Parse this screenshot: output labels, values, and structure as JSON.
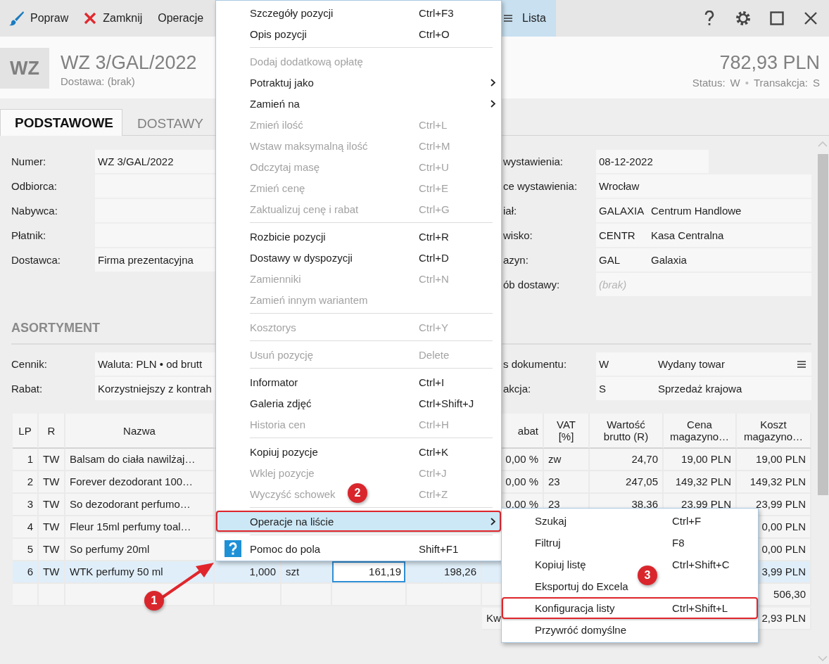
{
  "toolbar": {
    "buttons": [
      {
        "kind": "edit",
        "label": "Popraw"
      },
      {
        "kind": "close",
        "label": "Zamknij"
      },
      {
        "kind": "plain",
        "label": "Operacje"
      }
    ],
    "view_tab": {
      "label": "Lista",
      "selected": true
    }
  },
  "header": {
    "badge": "WZ",
    "title": "WZ 3/GAL/2022",
    "subtitle": "Dostawa: (brak)",
    "amount": "782,93 PLN",
    "status_separator": "•",
    "status": [
      {
        "label": "Status:",
        "value": "W"
      },
      {
        "label": "Transakcja:",
        "value": "S"
      }
    ]
  },
  "tabs": [
    {
      "label": "PODSTAWOWE",
      "selected": true
    },
    {
      "label": "DOSTAWY",
      "selected": false
    }
  ],
  "form_left": [
    {
      "label": "Numer:",
      "value": "WZ 3/GAL/2022"
    },
    {
      "label": "Odbiorca:"
    },
    {
      "label": "Nabywca:"
    },
    {
      "label": "Płatnik:"
    },
    {
      "label": "Dostawca:",
      "value": "Firma prezentacyjna"
    }
  ],
  "form_right": [
    {
      "kind": "date",
      "label": "wystawienia:",
      "value": "08-12-2022"
    },
    {
      "kind": "text",
      "label": "ce wystawienia:",
      "value": "Wrocław"
    },
    {
      "kind": "coded",
      "label": "iał:",
      "code": "GALAXIA",
      "value": "Centrum Handlowe"
    },
    {
      "kind": "coded",
      "label": "wisko:",
      "code": "CENTR",
      "value": "Kasa Centralna"
    },
    {
      "kind": "coded",
      "label": "azyn:",
      "code": "GAL",
      "value": "Galaxia"
    },
    {
      "kind": "text",
      "label": "ób dostawy:",
      "placeholder": "(brak)"
    }
  ],
  "section_title": "ASORTYMENT",
  "assortment_left": [
    {
      "label": "Cennik:",
      "value": "Waluta: PLN • od brutt"
    },
    {
      "label": "Rabat:",
      "value": "Korzystniejszy z kontrah"
    }
  ],
  "assortment_right": [
    {
      "label": "s dokumentu:",
      "code": "W",
      "value": "Wydany towar",
      "menu": true
    },
    {
      "label": "akcja:",
      "code": "S",
      "value": "Sprzedaż krajowa",
      "menu": false
    }
  ],
  "table": {
    "header": {
      "lp": "LP",
      "r": "R",
      "name": "Nazwa",
      "discount": "abat",
      "vat": "VAT [%]",
      "gross": "Wartość brutto (R)",
      "cost_price": "Cena magazyno…",
      "cost": "Koszt magazyno…"
    },
    "rows": [
      {
        "lp": "1",
        "r": "TW",
        "name": "Balsam do ciała nawilżaj…",
        "discount": "0,00 %",
        "vat": "zw",
        "gross": "24,70",
        "cost_price": "19,00 PLN",
        "cost": "19,00 PLN",
        "selected": false
      },
      {
        "lp": "2",
        "r": "TW",
        "name": "Forever dezodorant 100…",
        "discount": "0,00 %",
        "vat": "23",
        "gross": "247,05",
        "cost_price": "149,32 PLN",
        "cost": "149,32 PLN",
        "selected": false
      },
      {
        "lp": "3",
        "r": "TW",
        "name": "So dezodorant perfumo…",
        "discount": "0,00 %",
        "vat": "23",
        "gross": "38,36",
        "cost_price": "23,99 PLN",
        "cost": "23,99 PLN",
        "selected": false
      },
      {
        "lp": "4",
        "r": "TW",
        "name": "Fleur 15ml perfumy toal…",
        "cost": "0,00 PLN",
        "selected": false
      },
      {
        "lp": "5",
        "r": "TW",
        "name": "So perfumy 20ml",
        "cost": "0,00 PLN",
        "selected": false
      },
      {
        "lp": "6",
        "r": "TW",
        "name": "WTK perfumy 50 ml",
        "quantity": "1,000",
        "unit": "szt",
        "price": "161,19",
        "value": "198,26",
        "cost": "3,99 PLN",
        "selected": true,
        "editing": true
      }
    ],
    "footer": {
      "cost": "506,30"
    },
    "summary": {
      "label": "Kw",
      "value": "2,93 PLN"
    }
  },
  "context_menu": {
    "items": [
      {
        "kind": "command",
        "label": "Szczegóły pozycji",
        "shortcut": "Ctrl+F3",
        "disabled": false,
        "selected": false,
        "submenu": false,
        "outlined": false
      },
      {
        "kind": "command",
        "label": "Opis pozycji",
        "shortcut": "Ctrl+O",
        "disabled": false,
        "selected": false,
        "submenu": false,
        "outlined": false
      },
      {
        "kind": "separator"
      },
      {
        "kind": "command",
        "label": "Dodaj dodatkową opłatę",
        "disabled": true,
        "selected": false,
        "submenu": false,
        "outlined": false
      },
      {
        "kind": "command",
        "label": "Potraktuj jako",
        "disabled": false,
        "selected": false,
        "submenu": true,
        "outlined": false
      },
      {
        "kind": "command",
        "label": "Zamień na",
        "disabled": false,
        "selected": false,
        "submenu": true,
        "outlined": false
      },
      {
        "kind": "command",
        "label": "Zmień ilość",
        "shortcut": "Ctrl+L",
        "disabled": true,
        "selected": false,
        "submenu": false,
        "outlined": false
      },
      {
        "kind": "command",
        "label": "Wstaw maksymalną ilość",
        "shortcut": "Ctrl+M",
        "disabled": true,
        "selected": false,
        "submenu": false,
        "outlined": false
      },
      {
        "kind": "command",
        "label": "Odczytaj masę",
        "shortcut": "Ctrl+U",
        "disabled": true,
        "selected": false,
        "submenu": false,
        "outlined": false
      },
      {
        "kind": "command",
        "label": "Zmień cenę",
        "shortcut": "Ctrl+E",
        "disabled": true,
        "selected": false,
        "submenu": false,
        "outlined": false
      },
      {
        "kind": "command",
        "label": "Zaktualizuj cenę i rabat",
        "shortcut": "Ctrl+G",
        "disabled": true,
        "selected": false,
        "submenu": false,
        "outlined": false
      },
      {
        "kind": "separator"
      },
      {
        "kind": "command",
        "label": "Rozbicie pozycji",
        "shortcut": "Ctrl+R",
        "disabled": false,
        "selected": false,
        "submenu": false,
        "outlined": false
      },
      {
        "kind": "command",
        "label": "Dostawy w dyspozycji",
        "shortcut": "Ctrl+D",
        "disabled": false,
        "selected": false,
        "submenu": false,
        "outlined": false
      },
      {
        "kind": "command",
        "label": "Zamienniki",
        "shortcut": "Ctrl+N",
        "disabled": true,
        "selected": false,
        "submenu": false,
        "outlined": false
      },
      {
        "kind": "command",
        "label": "Zamień innym wariantem",
        "disabled": true,
        "selected": false,
        "submenu": false,
        "outlined": false
      },
      {
        "kind": "separator"
      },
      {
        "kind": "command",
        "label": "Kosztorys",
        "shortcut": "Ctrl+Y",
        "disabled": true,
        "selected": false,
        "submenu": false,
        "outlined": false
      },
      {
        "kind": "separator"
      },
      {
        "kind": "command",
        "label": "Usuń pozycję",
        "shortcut": "Delete",
        "disabled": true,
        "selected": false,
        "submenu": false,
        "outlined": false
      },
      {
        "kind": "separator"
      },
      {
        "kind": "command",
        "label": "Informator",
        "shortcut": "Ctrl+I",
        "disabled": false,
        "selected": false,
        "submenu": false,
        "outlined": false
      },
      {
        "kind": "command",
        "label": "Galeria zdjęć",
        "shortcut": "Ctrl+Shift+J",
        "disabled": false,
        "selected": false,
        "submenu": false,
        "outlined": false
      },
      {
        "kind": "command",
        "label": "Historia cen",
        "shortcut": "Ctrl+H",
        "disabled": true,
        "selected": false,
        "submenu": false,
        "outlined": false
      },
      {
        "kind": "separator"
      },
      {
        "kind": "command",
        "label": "Kopiuj pozycje",
        "shortcut": "Ctrl+K",
        "disabled": false,
        "selected": false,
        "submenu": false,
        "outlined": false
      },
      {
        "kind": "command",
        "label": "Wklej pozycje",
        "shortcut": "Ctrl+J",
        "disabled": true,
        "selected": false,
        "submenu": false,
        "outlined": false
      },
      {
        "kind": "command",
        "label": "Wyczyść schowek",
        "shortcut": "Ctrl+Z",
        "disabled": true,
        "selected": false,
        "submenu": false,
        "outlined": false
      },
      {
        "kind": "separator"
      },
      {
        "kind": "command",
        "label": "Operacje na liście",
        "disabled": false,
        "selected": true,
        "submenu": true,
        "outlined": true
      },
      {
        "kind": "separator"
      },
      {
        "kind": "help",
        "label": "Pomoc do pola",
        "shortcut": "Shift+F1",
        "disabled": false,
        "selected": false,
        "submenu": false,
        "outlined": false
      }
    ]
  },
  "submenu": {
    "items": [
      {
        "kind": "command",
        "label": "Szukaj",
        "shortcut": "Ctrl+F",
        "disabled": false,
        "selected": false,
        "submenu": false,
        "outlined": false
      },
      {
        "kind": "command",
        "label": "Filtruj",
        "shortcut": "F8",
        "disabled": false,
        "selected": false,
        "submenu": false,
        "outlined": false
      },
      {
        "kind": "command",
        "label": "Kopiuj listę",
        "shortcut": "Ctrl+Shift+C",
        "disabled": false,
        "selected": false,
        "submenu": false,
        "outlined": false
      },
      {
        "kind": "command",
        "label": "Eksportuj do Excela",
        "disabled": false,
        "selected": false,
        "submenu": false,
        "outlined": false
      },
      {
        "kind": "command",
        "label": "Konfiguracja listy",
        "shortcut": "Ctrl+Shift+L",
        "disabled": false,
        "selected": false,
        "submenu": false,
        "outlined": true
      },
      {
        "kind": "command",
        "label": "Przywróć domyślne",
        "disabled": false,
        "selected": false,
        "submenu": false,
        "outlined": false
      }
    ]
  },
  "annotations": {
    "arrow": true,
    "badges": [
      {
        "label": "1"
      },
      {
        "label": "2"
      },
      {
        "label": "3"
      }
    ]
  }
}
